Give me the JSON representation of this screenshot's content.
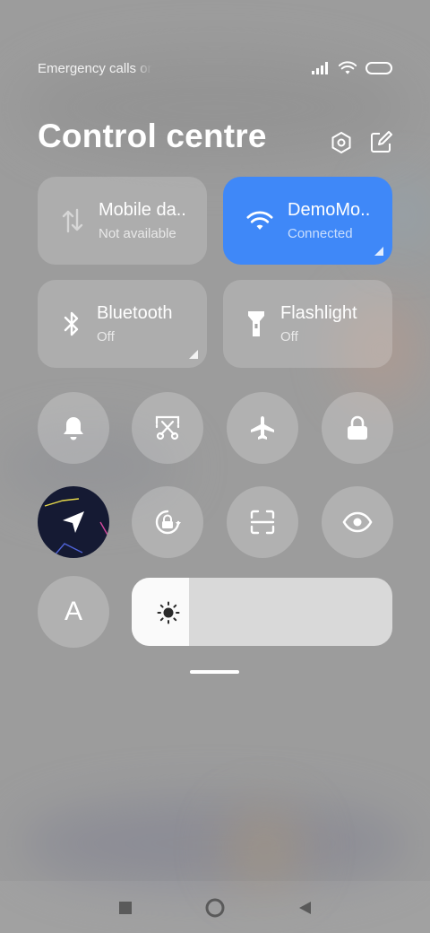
{
  "status_bar": {
    "carrier_text": "Emergency calls only",
    "icons": [
      "signal-icon",
      "wifi-icon",
      "battery-icon"
    ]
  },
  "header": {
    "title": "Control centre",
    "actions": [
      "settings-icon",
      "edit-icon"
    ]
  },
  "tiles": [
    {
      "id": "mobile-data",
      "title": "Mobile da..",
      "subtitle": "Not available",
      "icon": "mobile-data-icon",
      "active": false
    },
    {
      "id": "wifi",
      "title": "DemoMo..",
      "subtitle": "Connected",
      "icon": "wifi-icon",
      "active": true
    },
    {
      "id": "bluetooth",
      "title": "Bluetooth",
      "subtitle": "Off",
      "icon": "bluetooth-icon",
      "active": false
    },
    {
      "id": "flashlight",
      "title": "Flashlight",
      "subtitle": "Off",
      "icon": "flashlight-icon",
      "active": false
    }
  ],
  "toggles": [
    {
      "id": "ringer",
      "icon": "bell-icon"
    },
    {
      "id": "screenshot",
      "icon": "scissors-icon"
    },
    {
      "id": "airplane",
      "icon": "airplane-icon"
    },
    {
      "id": "lock-screen",
      "icon": "lock-icon"
    },
    {
      "id": "location",
      "icon": "location-icon",
      "active": true
    },
    {
      "id": "auto-rotate",
      "icon": "rotate-lock-icon"
    },
    {
      "id": "scanner",
      "icon": "scan-icon"
    },
    {
      "id": "reading-mode",
      "icon": "eye-icon"
    },
    {
      "id": "auto-brightness",
      "icon": "font-a-icon",
      "label": "A"
    }
  ],
  "brightness": {
    "level": 0.22,
    "icon": "sun-icon"
  },
  "colors": {
    "accent": "#3f88f8",
    "location_bg": "#151a33"
  },
  "navbar": {
    "buttons": [
      "recents-icon",
      "home-icon",
      "back-icon"
    ]
  }
}
